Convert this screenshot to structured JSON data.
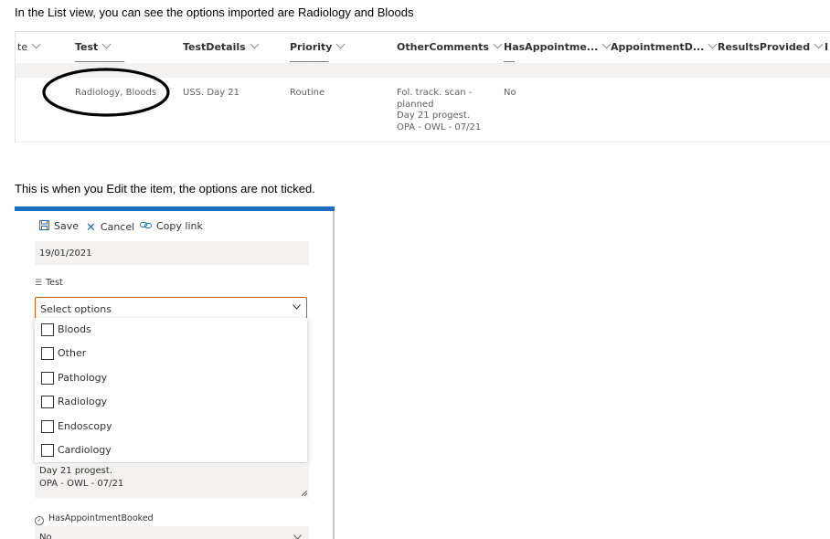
{
  "caption_list": "In the List view, you can see the options imported are Radiology and Bloods",
  "caption_edit": "This is when you Edit the item, the options are not ticked.",
  "list": {
    "columns": [
      "te",
      "Test",
      "TestDetails",
      "Priority",
      "OtherComments",
      "HasAppointme...",
      "AppointmentD...",
      "ResultsProvided",
      "I"
    ],
    "row": {
      "test": "Radiology, Bloods",
      "test_details": "USS. Day 21",
      "priority": "Routine",
      "other_comments": [
        "Fol. track. scan -",
        "planned",
        "Day 21 progest.",
        "OPA - OWL - 07/21"
      ],
      "has_appointment": "No"
    }
  },
  "form": {
    "save_label": "Save",
    "cancel_label": "Cancel",
    "copy_link_label": "Copy link",
    "date_value": "19/01/2021",
    "test_label": "Test",
    "select_placeholder": "Select options",
    "options": [
      {
        "label": "Bloods",
        "checked": false
      },
      {
        "label": "Other",
        "checked": false
      },
      {
        "label": "Pathology",
        "checked": false
      },
      {
        "label": "Radiology",
        "checked": false
      },
      {
        "label": "Endoscopy",
        "checked": false
      },
      {
        "label": "Cardiology",
        "checked": false
      }
    ],
    "comments_lines": [
      "Day 21 progest.",
      "OPA - OWL - 07/21"
    ],
    "has_appointment_label": "HasAppointmentBooked",
    "has_appointment_value": "No"
  },
  "colors": {
    "accent": "#1b6ec2",
    "focus_border": "#c55a11",
    "field_bg": "#f3f2f1",
    "annotation": "#000000"
  }
}
